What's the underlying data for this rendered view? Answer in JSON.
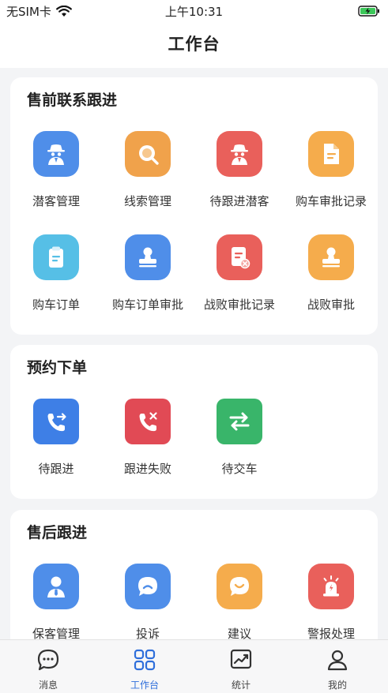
{
  "status_bar": {
    "carrier": "无SIM卡",
    "time": "上午10:31",
    "icons": [
      "wifi-icon",
      "battery-charging-icon"
    ]
  },
  "navbar": {
    "title": "工作台"
  },
  "sections": [
    {
      "title": "售前联系跟进",
      "items": [
        {
          "label": "潜客管理",
          "icon": "incognito-person-icon",
          "color": "#4f8ee9"
        },
        {
          "label": "线索管理",
          "icon": "magnifier-icon",
          "color": "#f0a24b"
        },
        {
          "label": "待跟进潜客",
          "icon": "incognito-person-icon",
          "color": "#e9605b"
        },
        {
          "label": "购车审批记录",
          "icon": "document-icon",
          "color": "#f5ac4c"
        },
        {
          "label": "购车订单",
          "icon": "clipboard-icon",
          "color": "#56bfe6"
        },
        {
          "label": "购车订单审批",
          "icon": "stamp-icon",
          "color": "#4f8ee9"
        },
        {
          "label": "战败审批记录",
          "icon": "document-reject-icon",
          "color": "#e9605b"
        },
        {
          "label": "战败审批",
          "icon": "stamp-icon",
          "color": "#f5ac4c"
        }
      ]
    },
    {
      "title": "预约下单",
      "items": [
        {
          "label": "待跟进",
          "icon": "phone-outgoing-icon",
          "color": "#3e7fe6"
        },
        {
          "label": "跟进失败",
          "icon": "phone-missed-icon",
          "color": "#e14a55"
        },
        {
          "label": "待交车",
          "icon": "swap-arrows-icon",
          "color": "#39b56a"
        }
      ]
    },
    {
      "title": "售后跟进",
      "items": [
        {
          "label": "保客管理",
          "icon": "person-tie-icon",
          "color": "#4f8ee9"
        },
        {
          "label": "投诉",
          "icon": "sad-chat-icon",
          "color": "#4f8ee9"
        },
        {
          "label": "建议",
          "icon": "smile-chat-icon",
          "color": "#f5ac4c"
        },
        {
          "label": "警报处理",
          "icon": "alarm-light-icon",
          "color": "#e9605b"
        }
      ]
    }
  ],
  "tabs": [
    {
      "label": "消息",
      "icon": "chat-bubble-icon",
      "active": false
    },
    {
      "label": "工作台",
      "icon": "grid-icon",
      "active": true
    },
    {
      "label": "统计",
      "icon": "trend-chart-icon",
      "active": false
    },
    {
      "label": "我的",
      "icon": "user-icon",
      "active": false
    }
  ],
  "colors": {
    "accent": "#2f6fdb",
    "background": "#f3f4f6"
  }
}
